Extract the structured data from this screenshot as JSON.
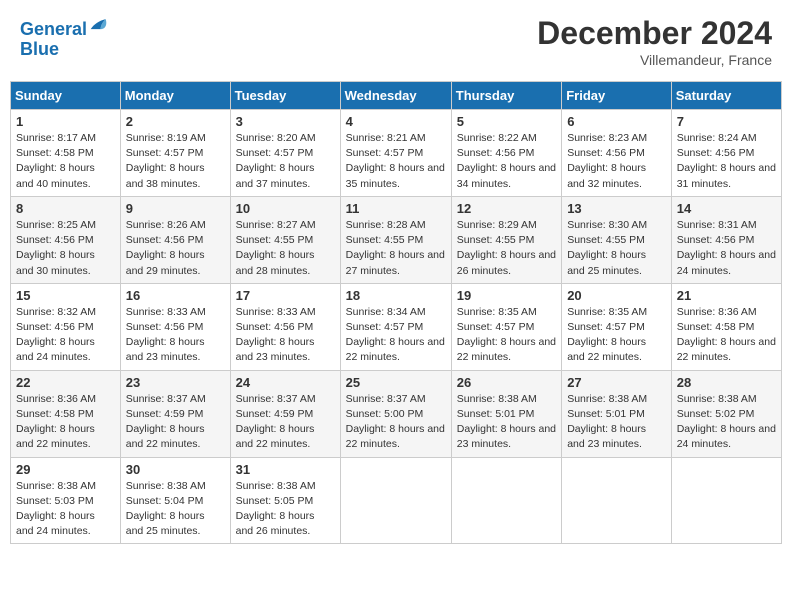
{
  "header": {
    "logo_line1": "General",
    "logo_line2": "Blue",
    "month_title": "December 2024",
    "location": "Villemandeur, France"
  },
  "days_of_week": [
    "Sunday",
    "Monday",
    "Tuesday",
    "Wednesday",
    "Thursday",
    "Friday",
    "Saturday"
  ],
  "weeks": [
    [
      {
        "day": "1",
        "sunrise": "Sunrise: 8:17 AM",
        "sunset": "Sunset: 4:58 PM",
        "daylight": "Daylight: 8 hours and 40 minutes."
      },
      {
        "day": "2",
        "sunrise": "Sunrise: 8:19 AM",
        "sunset": "Sunset: 4:57 PM",
        "daylight": "Daylight: 8 hours and 38 minutes."
      },
      {
        "day": "3",
        "sunrise": "Sunrise: 8:20 AM",
        "sunset": "Sunset: 4:57 PM",
        "daylight": "Daylight: 8 hours and 37 minutes."
      },
      {
        "day": "4",
        "sunrise": "Sunrise: 8:21 AM",
        "sunset": "Sunset: 4:57 PM",
        "daylight": "Daylight: 8 hours and 35 minutes."
      },
      {
        "day": "5",
        "sunrise": "Sunrise: 8:22 AM",
        "sunset": "Sunset: 4:56 PM",
        "daylight": "Daylight: 8 hours and 34 minutes."
      },
      {
        "day": "6",
        "sunrise": "Sunrise: 8:23 AM",
        "sunset": "Sunset: 4:56 PM",
        "daylight": "Daylight: 8 hours and 32 minutes."
      },
      {
        "day": "7",
        "sunrise": "Sunrise: 8:24 AM",
        "sunset": "Sunset: 4:56 PM",
        "daylight": "Daylight: 8 hours and 31 minutes."
      }
    ],
    [
      {
        "day": "8",
        "sunrise": "Sunrise: 8:25 AM",
        "sunset": "Sunset: 4:56 PM",
        "daylight": "Daylight: 8 hours and 30 minutes."
      },
      {
        "day": "9",
        "sunrise": "Sunrise: 8:26 AM",
        "sunset": "Sunset: 4:56 PM",
        "daylight": "Daylight: 8 hours and 29 minutes."
      },
      {
        "day": "10",
        "sunrise": "Sunrise: 8:27 AM",
        "sunset": "Sunset: 4:55 PM",
        "daylight": "Daylight: 8 hours and 28 minutes."
      },
      {
        "day": "11",
        "sunrise": "Sunrise: 8:28 AM",
        "sunset": "Sunset: 4:55 PM",
        "daylight": "Daylight: 8 hours and 27 minutes."
      },
      {
        "day": "12",
        "sunrise": "Sunrise: 8:29 AM",
        "sunset": "Sunset: 4:55 PM",
        "daylight": "Daylight: 8 hours and 26 minutes."
      },
      {
        "day": "13",
        "sunrise": "Sunrise: 8:30 AM",
        "sunset": "Sunset: 4:55 PM",
        "daylight": "Daylight: 8 hours and 25 minutes."
      },
      {
        "day": "14",
        "sunrise": "Sunrise: 8:31 AM",
        "sunset": "Sunset: 4:56 PM",
        "daylight": "Daylight: 8 hours and 24 minutes."
      }
    ],
    [
      {
        "day": "15",
        "sunrise": "Sunrise: 8:32 AM",
        "sunset": "Sunset: 4:56 PM",
        "daylight": "Daylight: 8 hours and 24 minutes."
      },
      {
        "day": "16",
        "sunrise": "Sunrise: 8:33 AM",
        "sunset": "Sunset: 4:56 PM",
        "daylight": "Daylight: 8 hours and 23 minutes."
      },
      {
        "day": "17",
        "sunrise": "Sunrise: 8:33 AM",
        "sunset": "Sunset: 4:56 PM",
        "daylight": "Daylight: 8 hours and 23 minutes."
      },
      {
        "day": "18",
        "sunrise": "Sunrise: 8:34 AM",
        "sunset": "Sunset: 4:57 PM",
        "daylight": "Daylight: 8 hours and 22 minutes."
      },
      {
        "day": "19",
        "sunrise": "Sunrise: 8:35 AM",
        "sunset": "Sunset: 4:57 PM",
        "daylight": "Daylight: 8 hours and 22 minutes."
      },
      {
        "day": "20",
        "sunrise": "Sunrise: 8:35 AM",
        "sunset": "Sunset: 4:57 PM",
        "daylight": "Daylight: 8 hours and 22 minutes."
      },
      {
        "day": "21",
        "sunrise": "Sunrise: 8:36 AM",
        "sunset": "Sunset: 4:58 PM",
        "daylight": "Daylight: 8 hours and 22 minutes."
      }
    ],
    [
      {
        "day": "22",
        "sunrise": "Sunrise: 8:36 AM",
        "sunset": "Sunset: 4:58 PM",
        "daylight": "Daylight: 8 hours and 22 minutes."
      },
      {
        "day": "23",
        "sunrise": "Sunrise: 8:37 AM",
        "sunset": "Sunset: 4:59 PM",
        "daylight": "Daylight: 8 hours and 22 minutes."
      },
      {
        "day": "24",
        "sunrise": "Sunrise: 8:37 AM",
        "sunset": "Sunset: 4:59 PM",
        "daylight": "Daylight: 8 hours and 22 minutes."
      },
      {
        "day": "25",
        "sunrise": "Sunrise: 8:37 AM",
        "sunset": "Sunset: 5:00 PM",
        "daylight": "Daylight: 8 hours and 22 minutes."
      },
      {
        "day": "26",
        "sunrise": "Sunrise: 8:38 AM",
        "sunset": "Sunset: 5:01 PM",
        "daylight": "Daylight: 8 hours and 23 minutes."
      },
      {
        "day": "27",
        "sunrise": "Sunrise: 8:38 AM",
        "sunset": "Sunset: 5:01 PM",
        "daylight": "Daylight: 8 hours and 23 minutes."
      },
      {
        "day": "28",
        "sunrise": "Sunrise: 8:38 AM",
        "sunset": "Sunset: 5:02 PM",
        "daylight": "Daylight: 8 hours and 24 minutes."
      }
    ],
    [
      {
        "day": "29",
        "sunrise": "Sunrise: 8:38 AM",
        "sunset": "Sunset: 5:03 PM",
        "daylight": "Daylight: 8 hours and 24 minutes."
      },
      {
        "day": "30",
        "sunrise": "Sunrise: 8:38 AM",
        "sunset": "Sunset: 5:04 PM",
        "daylight": "Daylight: 8 hours and 25 minutes."
      },
      {
        "day": "31",
        "sunrise": "Sunrise: 8:38 AM",
        "sunset": "Sunset: 5:05 PM",
        "daylight": "Daylight: 8 hours and 26 minutes."
      },
      null,
      null,
      null,
      null
    ]
  ]
}
